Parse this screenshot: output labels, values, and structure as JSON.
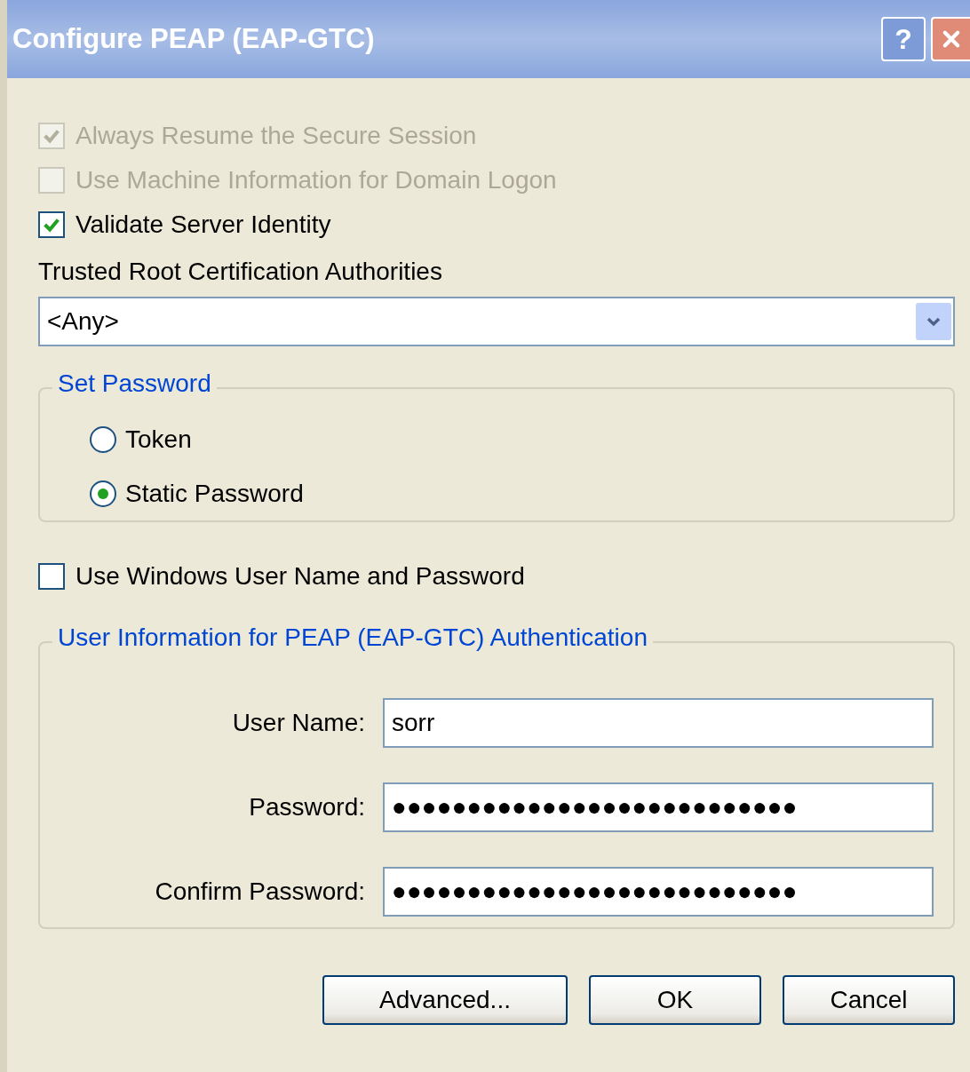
{
  "window": {
    "title": "Configure PEAP (EAP-GTC)",
    "help_button": "?"
  },
  "options": [
    {
      "label": "Always Resume the Secure Session",
      "checked": true,
      "disabled": true
    },
    {
      "label": "Use Machine Information for Domain Logon",
      "checked": false,
      "disabled": true
    },
    {
      "label": "Validate Server Identity",
      "checked": true,
      "disabled": false
    }
  ],
  "trusted_root": {
    "label": "Trusted Root Certification Authorities",
    "value": "<Any>"
  },
  "set_password": {
    "title": "Set Password",
    "radios": [
      {
        "label": "Token",
        "selected": false
      },
      {
        "label": "Static Password",
        "selected": true
      }
    ]
  },
  "windows_login": {
    "label": "Use Windows User Name and Password",
    "checked": false,
    "disabled": false
  },
  "user_info": {
    "title": "User Information for PEAP (EAP-GTC) Authentication",
    "fields": [
      {
        "label": "User Name:",
        "value": "sorr"
      },
      {
        "label": "Password:",
        "value": "●●●●●●●●●●●●●●●●●●●●●●●●●●●"
      },
      {
        "label": "Confirm Password:",
        "value": "●●●●●●●●●●●●●●●●●●●●●●●●●●●"
      }
    ]
  },
  "buttons": [
    "Advanced...",
    "OK",
    "Cancel"
  ]
}
